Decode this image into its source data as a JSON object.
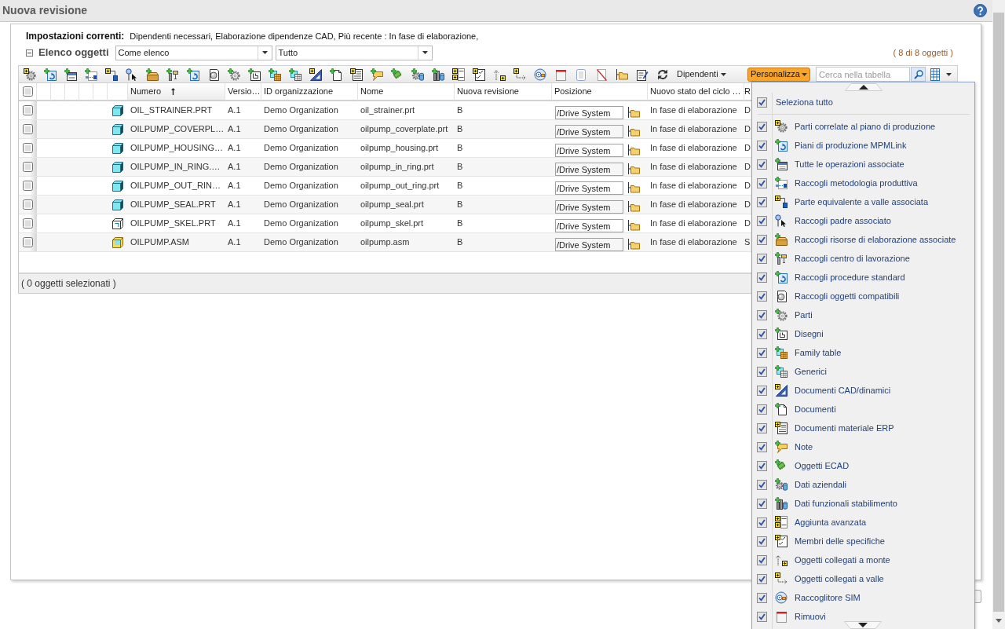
{
  "window": {
    "title": "Nuova revisione"
  },
  "current_settings": {
    "label": "Impostazioni correnti:",
    "value": "Dipendenti necessari, Elaborazione dipendenze CAD, Più recente : In fase di elaborazione,"
  },
  "object_list": {
    "title": "Elenco oggetti",
    "expanded": true,
    "view_select": "Come elenco",
    "filter_select": "Tutto",
    "count": "( 8 di 8 oggetti )"
  },
  "toolbar": {
    "dependents_menu": "Dipendenti",
    "customize_button": "Personalizza",
    "search": {
      "placeholder": "Cerca nella tabella"
    }
  },
  "table": {
    "header_checkbox": {
      "checked": false
    },
    "columns": [
      {
        "label": "Numero",
        "sorted": true
      },
      {
        "label": "Versio…",
        "sorted": false
      },
      {
        "label": "ID organizzazione",
        "sorted": false
      },
      {
        "label": "Nome",
        "sorted": false
      },
      {
        "label": "Nuova revisione",
        "sorted": false
      },
      {
        "label": "Posizione",
        "sorted": false
      },
      {
        "label": "Nuovo stato del ciclo …",
        "sorted": false
      },
      {
        "label": "R",
        "sorted": false
      }
    ],
    "rows": [
      {
        "checked": false,
        "kind": "part",
        "number": "OIL_STRAINER.PRT",
        "version": "A.1",
        "organization": "Demo Organization",
        "name": "oil_strainer.prt",
        "new_revision": "B",
        "location": "/Drive System",
        "new_state": "In fase di elaborazione",
        "column_8": "D"
      },
      {
        "checked": false,
        "kind": "part",
        "number": "OILPUMP_COVERPL…",
        "version": "A.1",
        "organization": "Demo Organization",
        "name": "oilpump_coverplate.prt",
        "new_revision": "B",
        "location": "/Drive System",
        "new_state": "In fase di elaborazione",
        "column_8": "D"
      },
      {
        "checked": false,
        "kind": "part",
        "number": "OILPUMP_HOUSING…",
        "version": "A.1",
        "organization": "Demo Organization",
        "name": "oilpump_housing.prt",
        "new_revision": "B",
        "location": "/Drive System",
        "new_state": "In fase di elaborazione",
        "column_8": "D"
      },
      {
        "checked": false,
        "kind": "part",
        "number": "OILPUMP_IN_RING.…",
        "version": "A.1",
        "organization": "Demo Organization",
        "name": "oilpump_in_ring.prt",
        "new_revision": "B",
        "location": "/Drive System",
        "new_state": "In fase di elaborazione",
        "column_8": "D"
      },
      {
        "checked": false,
        "kind": "part",
        "number": "OILPUMP_OUT_RIN…",
        "version": "A.1",
        "organization": "Demo Organization",
        "name": "oilpump_out_ring.prt",
        "new_revision": "B",
        "location": "/Drive System",
        "new_state": "In fase di elaborazione",
        "column_8": "D"
      },
      {
        "checked": false,
        "kind": "part",
        "number": "OILPUMP_SEAL.PRT",
        "version": "A.1",
        "organization": "Demo Organization",
        "name": "oilpump_seal.prt",
        "new_revision": "B",
        "location": "/Drive System",
        "new_state": "In fase di elaborazione",
        "column_8": "D"
      },
      {
        "checked": false,
        "kind": "skeleton",
        "number": "OILPUMP_SKEL.PRT",
        "version": "A.1",
        "organization": "Demo Organization",
        "name": "oilpump_skel.prt",
        "new_revision": "B",
        "location": "/Drive System",
        "new_state": "In fase di elaborazione",
        "column_8": "D"
      },
      {
        "checked": false,
        "kind": "assembly",
        "number": "OILPUMP.ASM",
        "version": "A.1",
        "organization": "Demo Organization",
        "name": "oilpump.asm",
        "new_revision": "B",
        "location": "/Drive System",
        "new_state": "In fase di elaborazione",
        "column_8": "S"
      }
    ],
    "footer": "( 0 oggetti selezionati )"
  },
  "customize_menu": {
    "select_all": {
      "label": "Seleziona tutto",
      "checked": true
    },
    "items": [
      {
        "label": "Parti correlate al piano di produzione",
        "checked": true
      },
      {
        "label": "Piani di produzione MPMLink",
        "checked": true
      },
      {
        "label": "Tutte le operazioni associate",
        "checked": true
      },
      {
        "label": "Raccogli metodologia produttiva",
        "checked": true
      },
      {
        "label": "Parte equivalente a valle associata",
        "checked": true
      },
      {
        "label": "Raccogli padre associato",
        "checked": true
      },
      {
        "label": "Raccogli risorse di elaborazione associate",
        "checked": true
      },
      {
        "label": "Raccogli centro di lavorazione",
        "checked": true
      },
      {
        "label": "Raccogli procedure standard",
        "checked": true
      },
      {
        "label": "Raccogli oggetti compatibili",
        "checked": true
      },
      {
        "label": "Parti",
        "checked": true
      },
      {
        "label": "Disegni",
        "checked": true
      },
      {
        "label": "Family table",
        "checked": true
      },
      {
        "label": "Generici",
        "checked": true
      },
      {
        "label": "Documenti CAD/dinamici",
        "checked": true
      },
      {
        "label": "Documenti",
        "checked": true
      },
      {
        "label": "Documenti materiale ERP",
        "checked": true
      },
      {
        "label": "Note",
        "checked": true
      },
      {
        "label": "Oggetti ECAD",
        "checked": true
      },
      {
        "label": "Dati aziendali",
        "checked": true
      },
      {
        "label": "Dati funzionali stabilimento",
        "checked": true
      },
      {
        "label": "Aggiunta avanzata",
        "checked": true
      },
      {
        "label": "Membri delle specifiche",
        "checked": true
      },
      {
        "label": "Oggetti collegati a monte",
        "checked": true
      },
      {
        "label": "Oggetti collegati a valle",
        "checked": true
      },
      {
        "label": "Raccoglitore SIM",
        "checked": true
      },
      {
        "label": "Rimuovi",
        "checked": true
      }
    ]
  }
}
